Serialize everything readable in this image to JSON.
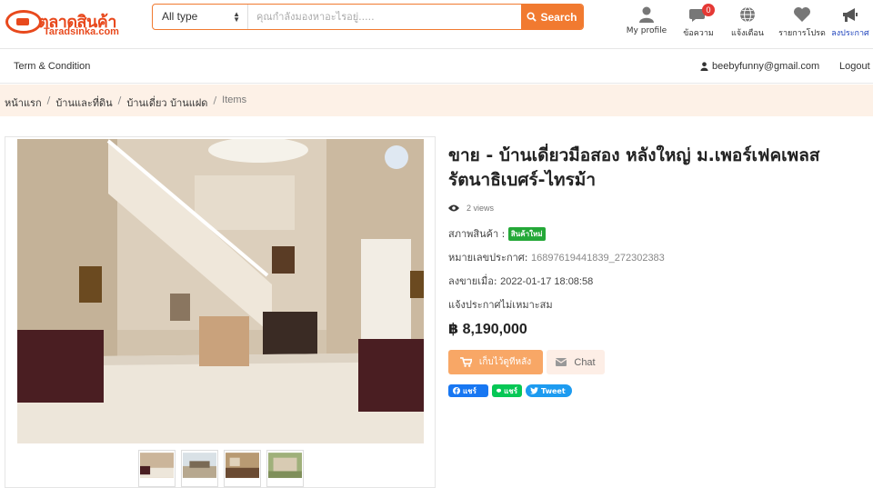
{
  "header": {
    "logo_th": "ตลาดสินค้า",
    "logo_en": "Taradsinka.com",
    "search": {
      "type_value": "All type",
      "placeholder": "คุณกำลังมองหาอะไรอยู่.....",
      "button_label": "Search"
    },
    "nav": [
      {
        "label": "My profile",
        "icon": "user-icon"
      },
      {
        "label": "ข้อความ",
        "icon": "chat-bubble-icon",
        "badge": "0"
      },
      {
        "label": "แจ้งเตือน",
        "icon": "globe-icon"
      },
      {
        "label": "รายการโปรด",
        "icon": "heart-icon"
      },
      {
        "label": "ลงประกาศ",
        "icon": "megaphone-icon"
      }
    ],
    "colors": {
      "brand": "#e8491d",
      "search_button": "#f17a30",
      "post_link": "#1a3fbb"
    }
  },
  "subbar": {
    "term_label": "Term & Condition",
    "user_email": "beebyfunny@gmail.com",
    "logout_label": "Logout"
  },
  "breadcrumb": [
    "หน้าแรก",
    "บ้านและที่ดิน",
    "บ้านเดี่ยว บ้านแฝด",
    "Items"
  ],
  "listing": {
    "title": "ขาย - บ้านเดี่ยวมือสอง หลังใหญ่ ม.เพอร์เฟคเพลส รัตนาธิเบศร์-ไทรม้า",
    "title_line1": "ขาย - บ้านเดี่ยวมือสอง หลังใหญ่ ม.เพอร์เฟคเพลส",
    "title_line2": "รัตนาธิเบศร์-ไทรม้า",
    "views": "2 views",
    "condition_label": "สภาพสินค้า :",
    "condition_value": "สินค้าใหม่",
    "ad_no_label": "หมายเลขประกาศ:",
    "ad_no_value": "16897619441839_272302383",
    "posted_label": "ลงขายเมื่อ:",
    "posted_value": "2022-01-17 18:08:58",
    "report_label": "แจ้งประกาศไม่เหมาะสม",
    "price": "฿ 8,190,000",
    "save_label": "เก็บไว้ดูทีหลัง",
    "chat_label": "Chat",
    "share_fb": "แชร์",
    "share_line": "แชร์",
    "share_tw": "Tweet"
  },
  "gallery": {
    "thumb_count": 4
  }
}
